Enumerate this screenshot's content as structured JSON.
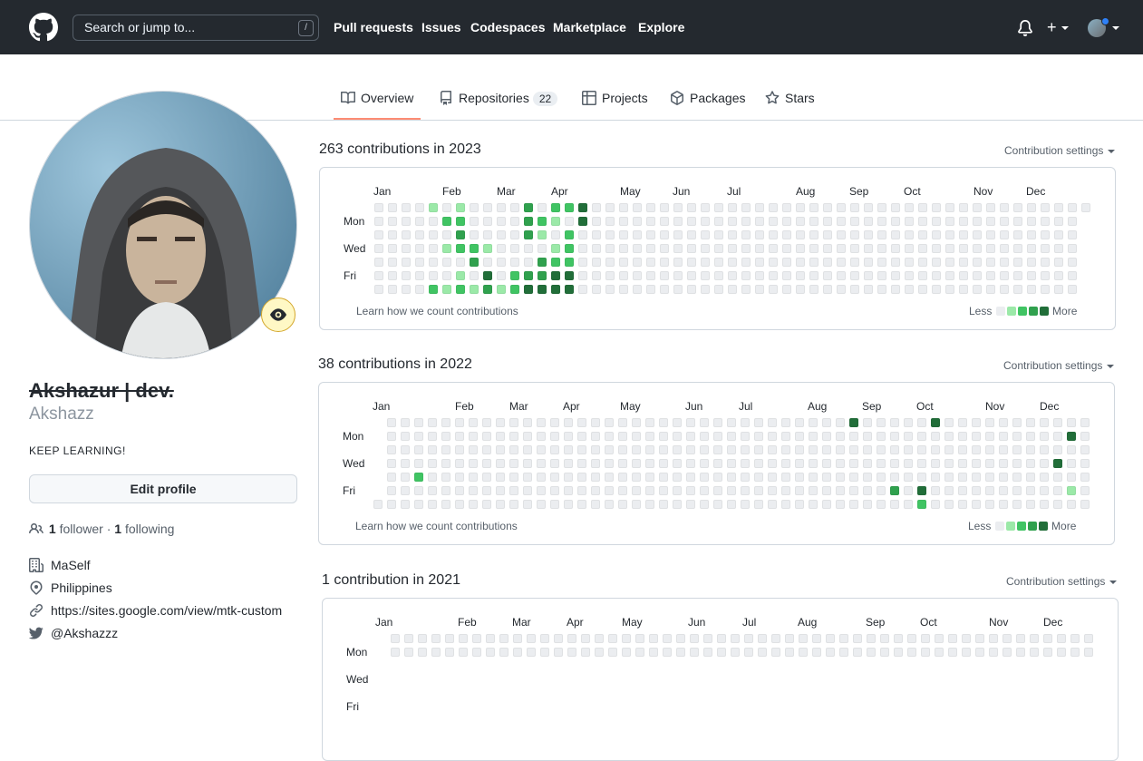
{
  "header": {
    "search_placeholder": "Search or jump to...",
    "search_shortcut": "/",
    "nav": [
      "Pull requests",
      "Issues",
      "Codespaces",
      "Marketplace",
      "Explore"
    ],
    "plus_label": "+"
  },
  "tabs": [
    {
      "label": "Overview",
      "icon": "book-icon",
      "selected": true
    },
    {
      "label": "Repositories",
      "icon": "repo-icon",
      "count": "22"
    },
    {
      "label": "Projects",
      "icon": "table-icon"
    },
    {
      "label": "Packages",
      "icon": "package-icon"
    },
    {
      "label": "Stars",
      "icon": "star-icon"
    }
  ],
  "profile": {
    "name": "Akshazur | dev.",
    "login": "Akshazz",
    "bio": "KEEP LEARNING!",
    "edit_label": "Edit profile",
    "followers_count": "1",
    "followers_label": "follower",
    "separator": "·",
    "following_count": "1",
    "following_label": "following",
    "company": "MaSelf",
    "location": "Philippines",
    "website": "https://sites.google.com/view/mtk-custom",
    "twitter": "@Akshazzz"
  },
  "contrib_common": {
    "settings_label": "Contribution settings",
    "learn_label": "Learn how we count contributions",
    "less_label": "Less",
    "more_label": "More",
    "day_labels": [
      "Mon",
      "Wed",
      "Fri"
    ],
    "colors": [
      "#ebedf0",
      "#9be9a8",
      "#40c463",
      "#30a14e",
      "#216e39"
    ]
  },
  "years": [
    {
      "title": "263 contributions in 2023",
      "months": [
        "Jan",
        "Feb",
        "Mar",
        "Apr",
        "May",
        "Jun",
        "Jul",
        "Aug",
        "Sep",
        "Oct",
        "Nov",
        "Dec"
      ],
      "weeks": 53,
      "first_weekday": 0,
      "last_week_days": 1,
      "active": [
        [
          4,
          0,
          1
        ],
        [
          4,
          6,
          2
        ],
        [
          5,
          1,
          2
        ],
        [
          5,
          3,
          1
        ],
        [
          5,
          6,
          1
        ],
        [
          6,
          0,
          1
        ],
        [
          6,
          1,
          2
        ],
        [
          6,
          2,
          3
        ],
        [
          6,
          3,
          2
        ],
        [
          6,
          5,
          1
        ],
        [
          6,
          6,
          2
        ],
        [
          7,
          3,
          2
        ],
        [
          7,
          4,
          3
        ],
        [
          7,
          6,
          1
        ],
        [
          8,
          3,
          1
        ],
        [
          8,
          5,
          4
        ],
        [
          8,
          6,
          3
        ],
        [
          9,
          6,
          1
        ],
        [
          10,
          5,
          2
        ],
        [
          10,
          6,
          2
        ],
        [
          11,
          0,
          3
        ],
        [
          11,
          1,
          3
        ],
        [
          11,
          2,
          3
        ],
        [
          11,
          5,
          3
        ],
        [
          11,
          6,
          4
        ],
        [
          12,
          1,
          2
        ],
        [
          12,
          2,
          1
        ],
        [
          12,
          4,
          3
        ],
        [
          12,
          5,
          3
        ],
        [
          12,
          6,
          4
        ],
        [
          13,
          0,
          2
        ],
        [
          13,
          1,
          1
        ],
        [
          13,
          3,
          1
        ],
        [
          13,
          4,
          2
        ],
        [
          13,
          5,
          4
        ],
        [
          13,
          6,
          4
        ],
        [
          14,
          0,
          2
        ],
        [
          14,
          2,
          2
        ],
        [
          14,
          3,
          2
        ],
        [
          14,
          4,
          2
        ],
        [
          14,
          5,
          4
        ],
        [
          14,
          6,
          4
        ],
        [
          15,
          0,
          4
        ],
        [
          15,
          1,
          4
        ]
      ]
    },
    {
      "title": "38 contributions in 2022",
      "months": [
        "Jan",
        "Feb",
        "Mar",
        "Apr",
        "May",
        "Jun",
        "Jul",
        "Aug",
        "Sep",
        "Oct",
        "Nov",
        "Dec"
      ],
      "weeks": 53,
      "first_weekday": 6,
      "last_week_days": 7,
      "active": [
        [
          3,
          4,
          2
        ],
        [
          35,
          0,
          4
        ],
        [
          38,
          5,
          3
        ],
        [
          40,
          5,
          4
        ],
        [
          40,
          6,
          2
        ],
        [
          41,
          0,
          4
        ],
        [
          50,
          3,
          4
        ],
        [
          51,
          1,
          4
        ],
        [
          51,
          5,
          1
        ]
      ]
    },
    {
      "title": "1 contribution in 2021",
      "months": [
        "Jan",
        "Feb",
        "Mar",
        "Apr",
        "May",
        "Jun",
        "Jul",
        "Aug",
        "Sep",
        "Oct",
        "Nov",
        "Dec"
      ],
      "weeks": 53,
      "first_weekday": 5,
      "last_week_days": 7,
      "active": []
    }
  ]
}
